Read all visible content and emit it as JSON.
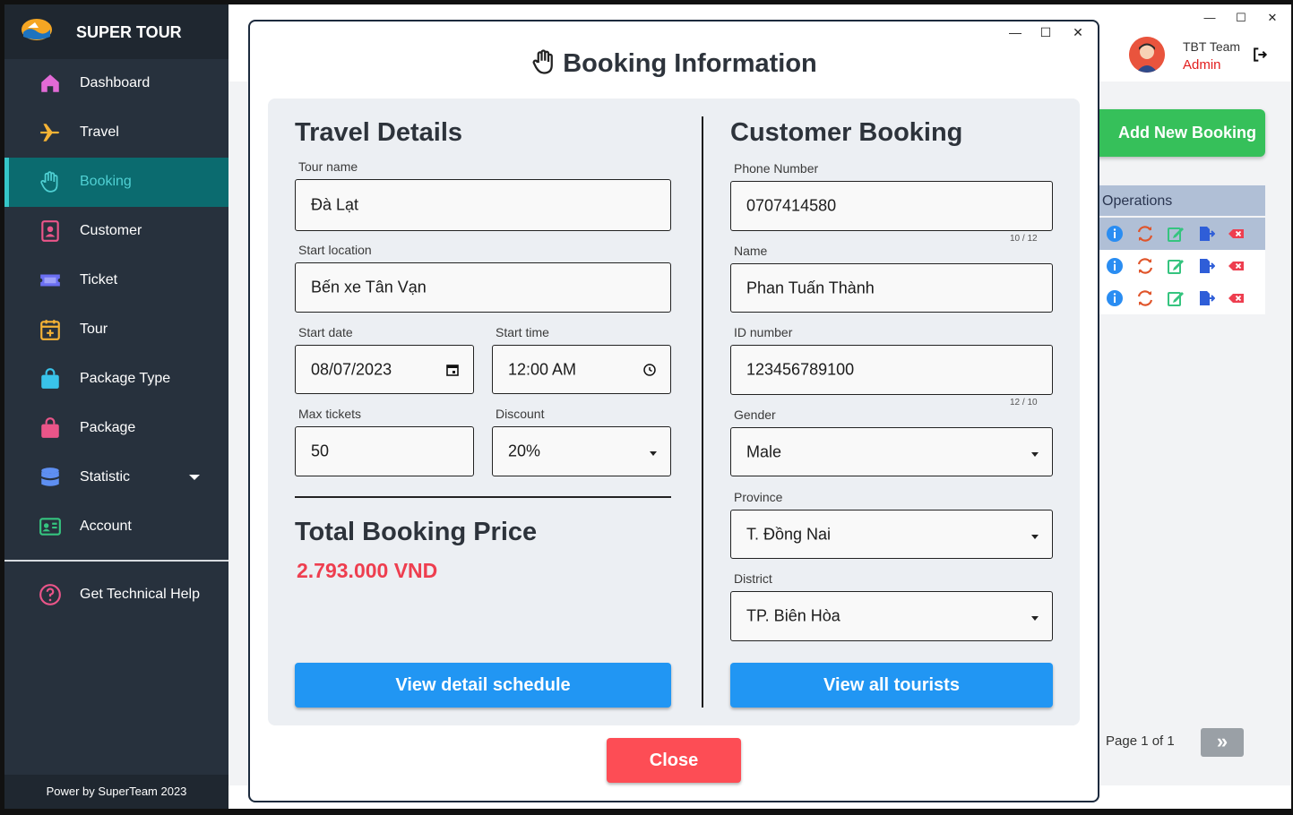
{
  "app": {
    "name": "SUPER TOUR",
    "footer": "Power by SuperTeam 2023"
  },
  "window_controls": {
    "minimize": "—",
    "maximize": "☐",
    "close": "✕"
  },
  "sidebar": {
    "items": [
      {
        "label": "Dashboard",
        "icon": "home-icon",
        "color": "#e26ad6"
      },
      {
        "label": "Travel",
        "icon": "plane-icon",
        "color": "#f5b335"
      },
      {
        "label": "Booking",
        "icon": "hand-icon",
        "color": "#4fd0d3",
        "active": true
      },
      {
        "label": "Customer",
        "icon": "contact-icon",
        "color": "#ea5589"
      },
      {
        "label": "Ticket",
        "icon": "ticket-icon",
        "color": "#6b6ff2"
      },
      {
        "label": "Tour",
        "icon": "calendar-plus-icon",
        "color": "#f5b335"
      },
      {
        "label": "Package Type",
        "icon": "bag-icon",
        "color": "#39c3ea"
      },
      {
        "label": "Package",
        "icon": "bag-icon",
        "color": "#ea5589"
      },
      {
        "label": "Statistic",
        "icon": "database-icon",
        "color": "#5e8ff2"
      },
      {
        "label": "Account",
        "icon": "id-card-icon",
        "color": "#35c47f"
      }
    ],
    "help": {
      "label": "Get Technical Help",
      "icon": "question-icon"
    }
  },
  "header": {
    "user_name": "TBT Team",
    "user_role": "Admin"
  },
  "background": {
    "add_button": "Add New Booking",
    "operations_header": "Operations",
    "page_info": "Page 1 of 1",
    "next_label": "»"
  },
  "modal": {
    "title": "Booking Information",
    "travel": {
      "title": "Travel Details",
      "tour_name_label": "Tour name",
      "tour_name": "Đà Lạt",
      "start_location_label": "Start location",
      "start_location": "Bến xe Tân Vạn",
      "start_date_label": "Start date",
      "start_date": "08/07/2023",
      "start_time_label": "Start time",
      "start_time": "12:00 AM",
      "max_tickets_label": "Max tickets",
      "max_tickets": "50",
      "discount_label": "Discount",
      "discount": "20%",
      "total_title": "Total Booking Price",
      "total_value": "2.793.000 VND",
      "schedule_button": "View detail schedule"
    },
    "customer": {
      "title": "Customer Booking",
      "phone_label": "Phone Number",
      "phone": "0707414580",
      "phone_counter": "10 / 12",
      "name_label": "Name",
      "name": "Phan Tuấn Thành",
      "id_label": "ID number",
      "id": "123456789100",
      "id_counter": "12 / 10",
      "gender_label": "Gender",
      "gender": "Male",
      "province_label": "Province",
      "province": "T. Đồng Nai",
      "district_label": "District",
      "district": "TP. Biên Hòa",
      "tourists_button": "View all tourists"
    },
    "close_button": "Close"
  }
}
